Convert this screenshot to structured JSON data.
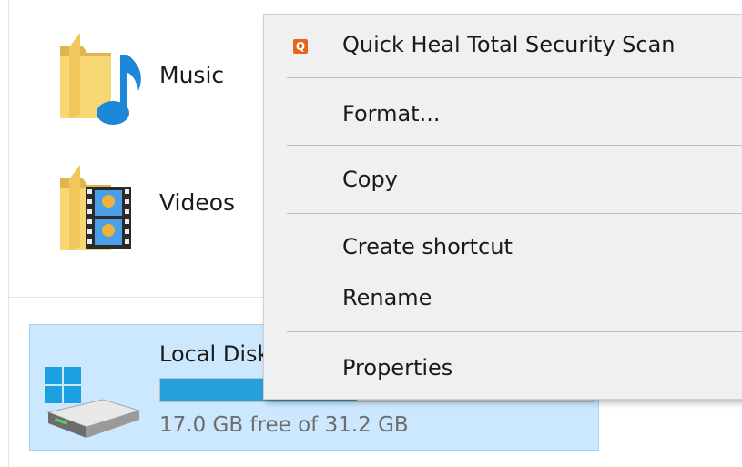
{
  "folders": [
    {
      "name": "Music",
      "icon": "music-folder-icon"
    },
    {
      "name": "Videos",
      "icon": "videos-folder-icon"
    }
  ],
  "drive": {
    "label": "Local Disk (C:)",
    "free_text": "17.0 GB free of 31.2 GB",
    "used_fraction": 0.455,
    "icon": "windows-drive-icon"
  },
  "context_menu": {
    "items": [
      {
        "label": "Quick Heal Total Security Scan",
        "icon": "quick-heal-icon"
      },
      {
        "label": "Format..."
      },
      {
        "label": "Copy"
      },
      {
        "label": "Create shortcut"
      },
      {
        "label": "Rename"
      },
      {
        "label": "Properties"
      }
    ]
  },
  "colors": {
    "selection_bg": "#cce8ff",
    "selection_border": "#99d1ff",
    "drive_bar_fill": "#26a0da",
    "menu_bg": "#f0f0f0",
    "quick_heal_orange": "#e8641e"
  }
}
